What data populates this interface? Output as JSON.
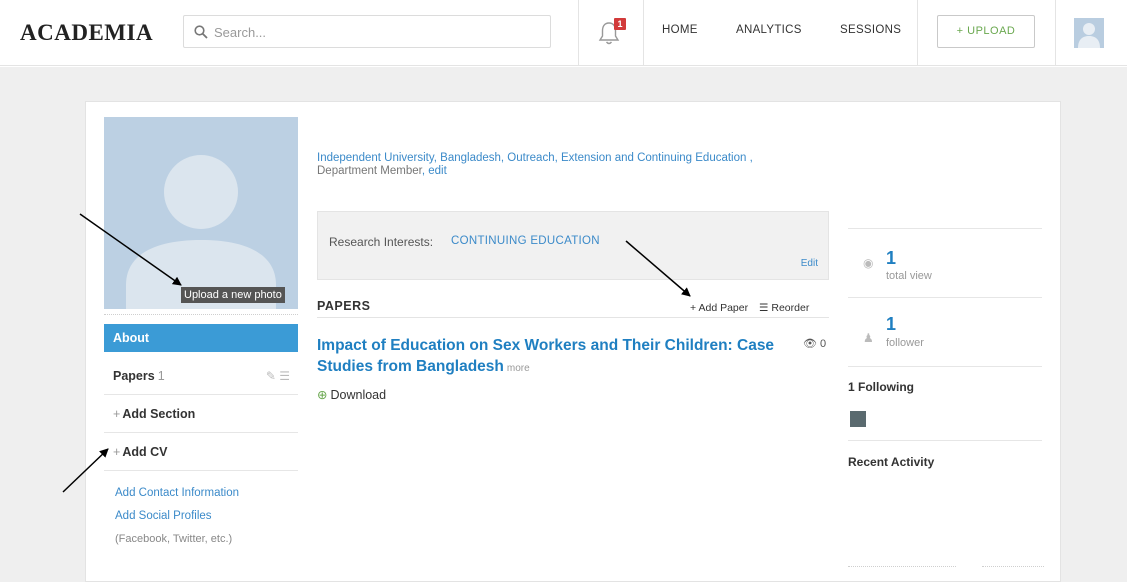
{
  "header": {
    "logo": "ACADEMIA",
    "search_placeholder": "Search...",
    "notification_count": "1",
    "nav": [
      "HOME",
      "ANALYTICS",
      "SESSIONS"
    ],
    "upload_label": "+ UPLOAD"
  },
  "profile": {
    "photo_label": "Upload a new photo",
    "affiliation": "Independent University, Bangladesh, Outreach, Extension and Continuing Education ,",
    "affiliation_role": "Department Member",
    "affiliation_edit": "edit"
  },
  "sidebar": {
    "about": "About",
    "papers_label": "Papers",
    "papers_count": "1",
    "add_section": "Add Section",
    "add_cv": "Add CV",
    "add_contact": "Add Contact Information",
    "add_social": "Add Social Profiles",
    "social_note": "(Facebook, Twitter, etc.)"
  },
  "research": {
    "label": "Research Interests:",
    "value": "CONTINUING EDUCATION",
    "edit": "Edit"
  },
  "papers": {
    "heading": "PAPERS",
    "add_paper": "Add Paper",
    "reorder": "Reorder",
    "items": [
      {
        "title": "Impact of Education on Sex Workers and Their Children: Case Studies from Bangladesh",
        "more": "more",
        "views": "0",
        "download": "Download"
      }
    ]
  },
  "stats": {
    "views_num": "1",
    "views_label": "total view",
    "followers_num": "1",
    "followers_label": "follower",
    "following": "1 Following",
    "recent_activity": "Recent Activity"
  },
  "colors": {
    "accent": "#3b9bd6",
    "link": "#1f7fc1",
    "upload_green": "#6aa84f",
    "badge_red": "#d23a3a"
  }
}
